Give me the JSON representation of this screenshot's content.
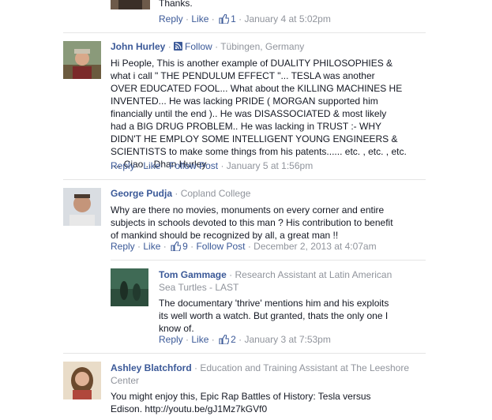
{
  "top_comment": {
    "text": "Thanks.",
    "reply": "Reply",
    "like": "Like",
    "like_count": "1",
    "time": "January 4 at 5:02pm"
  },
  "comments": [
    {
      "name": "John Hurley",
      "follow": "Follow",
      "location": "Tübingen, Germany",
      "text": "Hi People, This is another example of DUALITY PHILOSOPHIES &\nwhat i call \" THE PENDULUM EFFECT \"... TESLA was another\nOVER EDUCATED FOOL... What about the KILLING MACHINES HE\nINVENTED... He was lacking PRIDE ( MORGAN supported him\nfinancially until the end ).. He was DISASSOCIATED & most likely\nhad a BIG DRUG PROBLEM.. He was lacking in TRUST :- WHY\nDIDN'T HE EMPLOY SOME INTELLIGENT YOUNG ENGINEERS &\nSCIENTISTS to make some things from his patents...... etc. , etc. , etc.\n,... Ciao .. Dhan Hurley",
      "reply": "Reply",
      "like": "Like",
      "follow_post": "Follow Post",
      "time": "January 5 at 1:56pm"
    },
    {
      "name": "George Pudja",
      "affiliation": "Copland College",
      "text": "Why are there no movies, monuments on every corner and entire\nsubjects in schools devoted to this man ? His contribution to benefit\nof mankind should be recognized by all, a great man !!",
      "reply": "Reply",
      "like": "Like",
      "like_count": "9",
      "follow_post": "Follow Post",
      "time": "December 2, 2013 at 4:07am"
    },
    {
      "name": "Tom Gammage",
      "affiliation_line1": "Research Assistant at Latin American",
      "affiliation_line2": "Sea Turtles - LAST",
      "text": "The documentary 'thrive' mentions him and his exploits\nits well worth a watch. But granted, thats the only one I\nknow of.",
      "reply": "Reply",
      "like": "Like",
      "like_count": "2",
      "time": "January 3 at 7:53pm"
    },
    {
      "name": "Ashley Blatchford",
      "affiliation_line1": "Education and Training Assistant at The Leeshore",
      "affiliation_line2": "Center",
      "text": "You might enjoy this, Epic Rap Battles of History: Tesla versus\nEdison. http://youtu.be/gJ1Mz7kGVf0"
    }
  ],
  "colors": {
    "link": "#3b5998",
    "meta": "#90949c",
    "text": "#141823",
    "divider": "#e5e5e5"
  },
  "icons": [
    "thumbs-up-icon",
    "follow-rss-icon"
  ]
}
